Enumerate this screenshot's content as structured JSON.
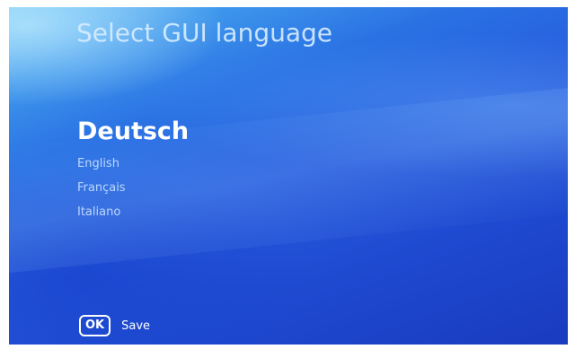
{
  "header": {
    "title": "Select GUI language"
  },
  "languages": [
    {
      "label": "Deutsch",
      "selected": true
    },
    {
      "label": "English",
      "selected": false
    },
    {
      "label": "Français",
      "selected": false
    },
    {
      "label": "Italiano",
      "selected": false
    }
  ],
  "footer": {
    "ok_button_label": "OK",
    "ok_action_label": "Save"
  },
  "colors": {
    "background_top": "#6fc3f4",
    "background_main": "#2658dc",
    "background_bottom": "#1a3bbe",
    "text": "#ffffff"
  }
}
